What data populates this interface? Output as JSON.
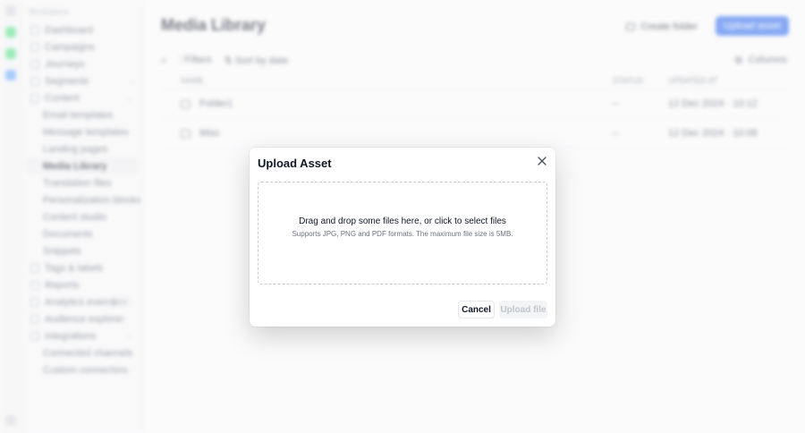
{
  "app": {
    "sidebar": {
      "header": "Workspace",
      "items": [
        {
          "label": "Dashboard",
          "level": 0
        },
        {
          "label": "Campaigns",
          "level": 0
        },
        {
          "label": "Journeys",
          "level": 0
        },
        {
          "label": "Segments",
          "level": 0,
          "chevron": "›"
        },
        {
          "label": "Content",
          "level": 0,
          "chevron": "⌄"
        },
        {
          "label": "Email templates",
          "level": 1
        },
        {
          "label": "Message templates",
          "level": 1
        },
        {
          "label": "Landing pages",
          "level": 1
        },
        {
          "label": "Media Library",
          "level": 1,
          "active": true
        },
        {
          "label": "Translation files",
          "level": 1
        },
        {
          "label": "Personalization blocks",
          "level": 1
        },
        {
          "label": "Content studio",
          "level": 1
        },
        {
          "label": "Documents",
          "level": 1
        },
        {
          "label": "Snippets",
          "level": 1
        },
        {
          "label": "Tags & labels",
          "level": 0
        },
        {
          "label": "Reports",
          "level": 0
        },
        {
          "label": "Analytics events",
          "level": 0,
          "badge": "New"
        },
        {
          "label": "Audience explorer",
          "level": 0
        },
        {
          "label": "Integrations",
          "level": 0,
          "chevron": "⌄"
        },
        {
          "label": "Connected channels",
          "level": 1
        },
        {
          "label": "Custom connectors",
          "level": 1
        }
      ]
    },
    "page_title": "Media Library",
    "create_folder_label": "Create folder",
    "upload_asset_label": "Upload asset",
    "toolbar": {
      "filters_label": "Filters",
      "sort_label": "Sort by date",
      "columns_label": "Columns"
    },
    "table": {
      "headers": [
        "NAME",
        "STATUS",
        "UPDATED AT"
      ],
      "rows": [
        {
          "name": "Folder1",
          "status": "–",
          "updated": "12 Dec 2024 · 10:12"
        },
        {
          "name": "Misc",
          "status": "–",
          "updated": "12 Dec 2024 · 10:08"
        }
      ]
    }
  },
  "modal": {
    "title": "Upload Asset",
    "dropzone_main": "Drag and drop some files here, or click to select files",
    "dropzone_sub": "Supports JPG, PNG and PDF formats. The maximum file size is 5MB.",
    "cancel_label": "Cancel",
    "upload_label": "Upload file"
  },
  "colors": {
    "primary": "#2563eb",
    "overlay": "#ffffff",
    "disabled_text": "#c2c6cc"
  }
}
